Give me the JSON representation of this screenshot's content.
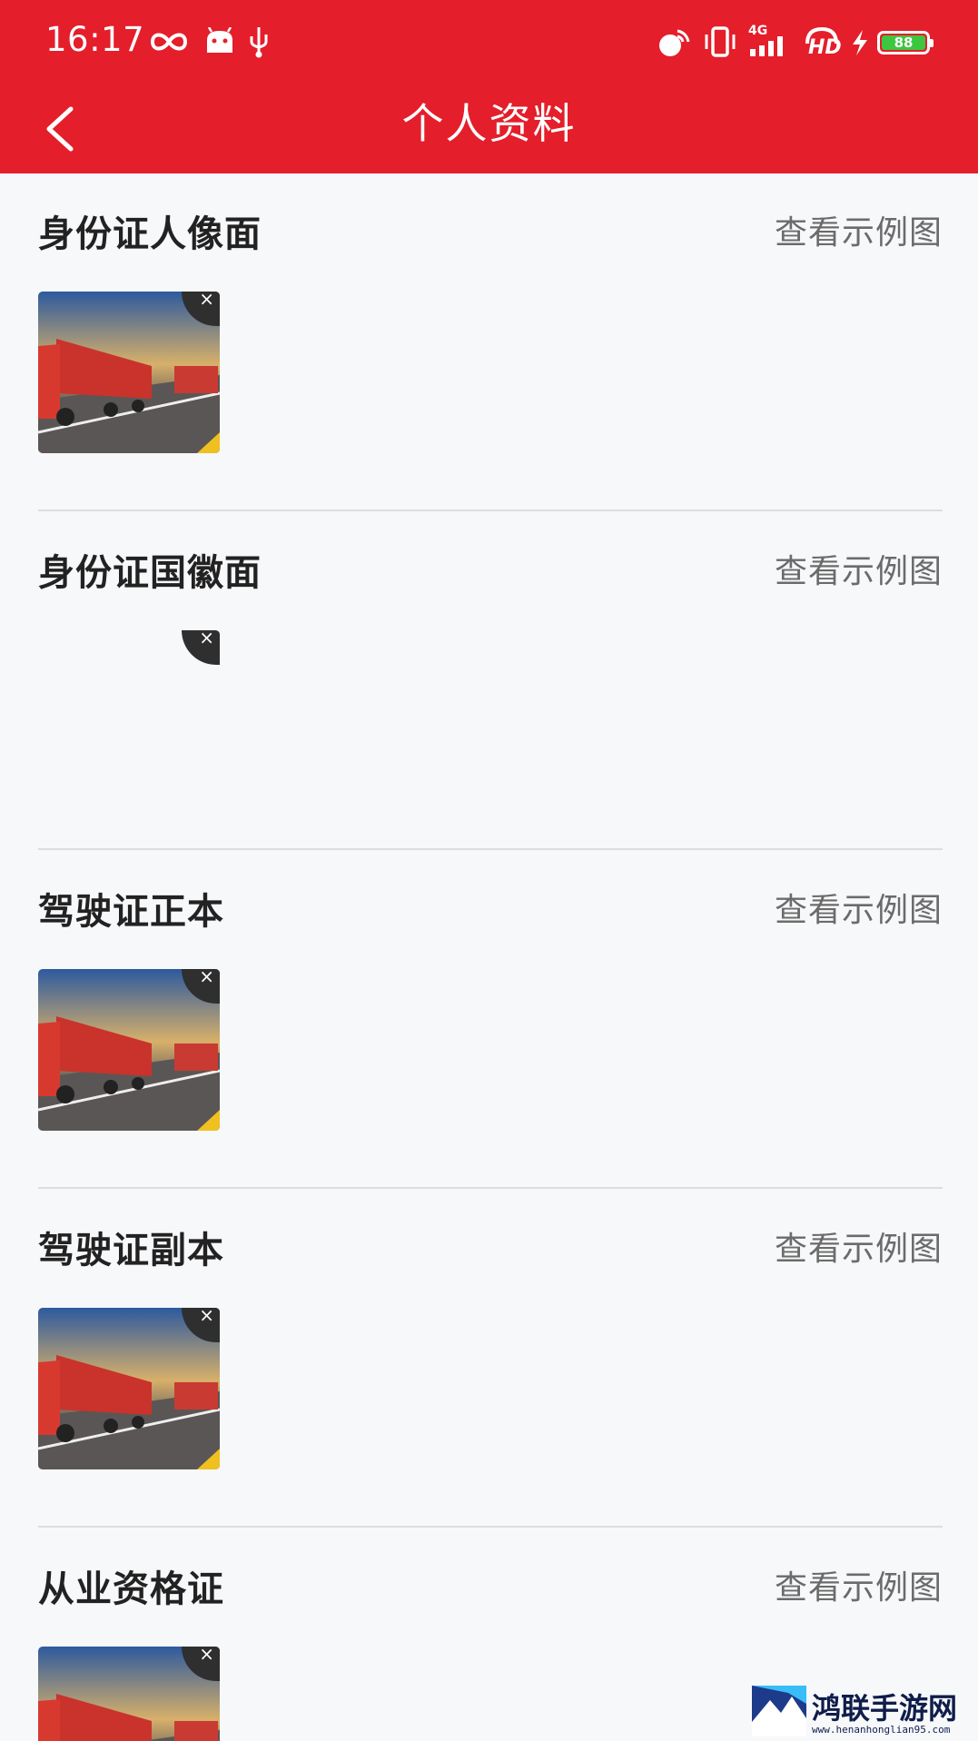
{
  "status_bar": {
    "time": "16:17",
    "network": "4G",
    "hd_label": "HD",
    "battery": "88"
  },
  "nav": {
    "title": "个人资料"
  },
  "sections": [
    {
      "title": "身份证人像面",
      "link": "查看示例图",
      "has_image": true
    },
    {
      "title": "身份证国徽面",
      "link": "查看示例图",
      "has_image": false
    },
    {
      "title": "驾驶证正本",
      "link": "查看示例图",
      "has_image": true
    },
    {
      "title": "驾驶证副本",
      "link": "查看示例图",
      "has_image": true
    },
    {
      "title": "从业资格证",
      "link": "查看示例图",
      "has_image": true
    }
  ],
  "remove_glyph": "×",
  "watermark": {
    "name": "鸿联手游网",
    "url": "www.henanhonglian95.com"
  },
  "colors": {
    "accent": "#e41e2a",
    "background": "#f7f8fa",
    "title_text": "#222222",
    "link_text": "#6b6b6b"
  }
}
